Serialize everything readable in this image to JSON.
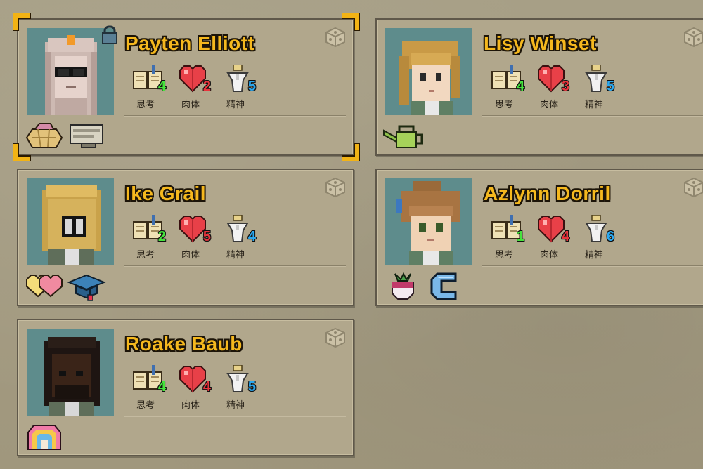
{
  "labels": {
    "mind": "思考",
    "body": "肉体",
    "spirit": "精神"
  },
  "colors": {
    "mind": "#45e23c",
    "body": "#e8343c",
    "spirit": "#2aa8f0",
    "name": "#f5b81e"
  },
  "characters": [
    {
      "name": "Payten Elliott",
      "mind": "4",
      "body": "2",
      "spirit": "5",
      "selected": true,
      "locked": true,
      "traits": [
        "basket-icon",
        "sign-board-icon"
      ]
    },
    {
      "name": "Lisy Winset",
      "mind": "4",
      "body": "3",
      "spirit": "5",
      "selected": false,
      "locked": false,
      "traits": [
        "watering-can-icon"
      ]
    },
    {
      "name": "Ike Grail",
      "mind": "2",
      "body": "5",
      "spirit": "4",
      "selected": false,
      "locked": false,
      "traits": [
        "two-hearts-icon",
        "graduation-cap-icon"
      ]
    },
    {
      "name": "Azlynn Dorril",
      "mind": "1",
      "body": "4",
      "spirit": "6",
      "selected": false,
      "locked": false,
      "traits": [
        "turnip-icon",
        "c-letter-icon"
      ]
    },
    {
      "name": "Roake Baub",
      "mind": "4",
      "body": "4",
      "spirit": "5",
      "selected": false,
      "locked": false,
      "traits": [
        "rainbow-arch-icon"
      ]
    }
  ]
}
